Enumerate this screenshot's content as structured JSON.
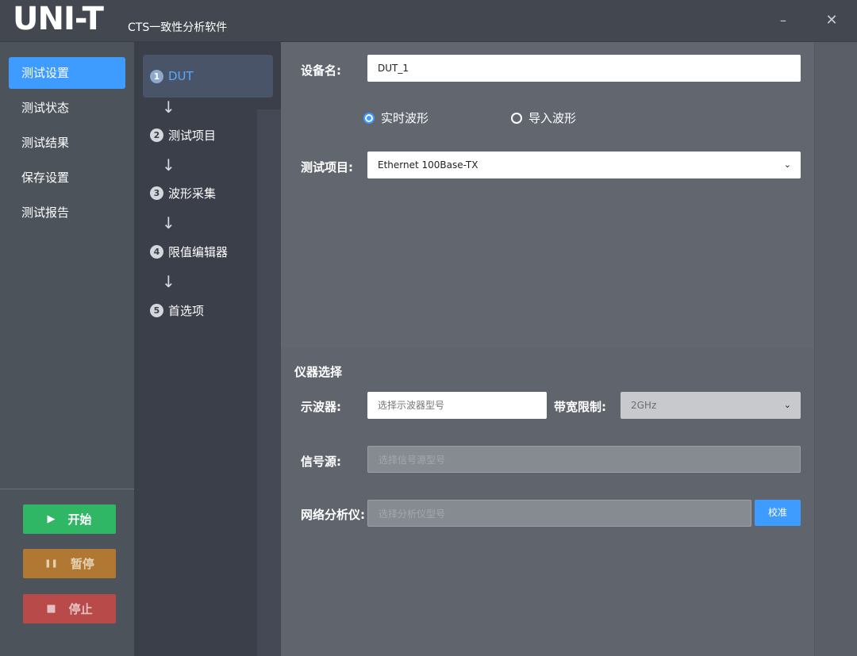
{
  "titlebar": {
    "logo": "UNI-T",
    "app_name": "CTS一致性分析软件",
    "minimize": "–",
    "close": "✕"
  },
  "sidebar": {
    "items": [
      {
        "label": "测试设置",
        "active": true
      },
      {
        "label": "测试状态",
        "active": false
      },
      {
        "label": "测试结果",
        "active": false
      },
      {
        "label": "保存设置",
        "active": false
      },
      {
        "label": "测试报告",
        "active": false
      }
    ],
    "controls": {
      "start": "开始",
      "pause": "暂停",
      "stop": "停止"
    }
  },
  "steps": [
    {
      "num": "1",
      "label": "DUT",
      "active": true
    },
    {
      "num": "2",
      "label": "测试项目",
      "active": false
    },
    {
      "num": "3",
      "label": "波形采集",
      "active": false
    },
    {
      "num": "4",
      "label": "限值编辑器",
      "active": false
    },
    {
      "num": "5",
      "label": "首选项",
      "active": false
    }
  ],
  "arrow_glyph": "↓",
  "dut": {
    "device_name_label": "设备名:",
    "device_name_value": "DUT_1",
    "radio_realtime": "实时波形",
    "radio_import": "导入波形",
    "test_item_label": "测试项目:",
    "test_item_value": "Ethernet 100Base-TX"
  },
  "instruments": {
    "section_title": "仪器选择",
    "scope_label": "示波器:",
    "scope_placeholder": "选择示波器型号",
    "bandwidth_label": "带宽限制:",
    "bandwidth_value": "2GHz",
    "signal_label": "信号源:",
    "signal_placeholder": "选择信号源型号",
    "vna_label": "网络分析仪:",
    "vna_placeholder": "选择分析仪型号",
    "calibrate": "校准"
  },
  "colors": {
    "accent": "#3e9bff",
    "start": "#2fb766",
    "pause": "#b17834",
    "stop": "#b84a4a"
  }
}
